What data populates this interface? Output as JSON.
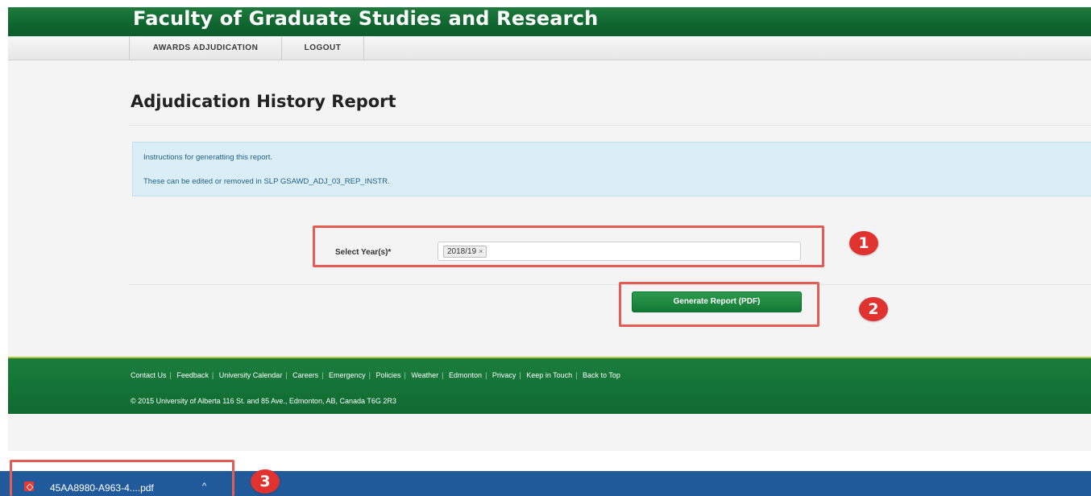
{
  "header": {
    "title": "Faculty of Graduate Studies and Research"
  },
  "nav": {
    "items": [
      {
        "label": "AWARDS ADJUDICATION"
      },
      {
        "label": "LOGOUT"
      }
    ]
  },
  "page": {
    "title": "Adjudication History Report"
  },
  "instructions": {
    "line1": "Instructions for generatting this report.",
    "line2": "These can be edited or removed in SLP GSAWD_ADJ_03_REP_INSTR."
  },
  "form": {
    "year_label": "Select Year(s)*",
    "selected_years": [
      "2018/19"
    ],
    "chip_remove": "×"
  },
  "actions": {
    "generate_label": "Generate Report (PDF)"
  },
  "footer": {
    "links": [
      "Contact Us",
      "Feedback",
      "University Calendar",
      "Careers",
      "Emergency",
      "Policies",
      "Weather",
      "Edmonton",
      "Privacy",
      "Keep in Touch",
      "Back to Top"
    ],
    "copyright": "© 2015 University of Alberta 116 St. and 85 Ave., Edmonton, AB, Canada T6G 2R3"
  },
  "annotations": {
    "step1": "1",
    "step2": "2",
    "step3": "3"
  },
  "download": {
    "filename": "45AA8980-A963-4....pdf",
    "icon": "pdf-file-icon",
    "chevron": "^"
  },
  "colors": {
    "header_green": "#0f6630",
    "annotation_red": "#e55b55",
    "badge_red": "#e0322f",
    "download_bar": "#215a9b"
  }
}
